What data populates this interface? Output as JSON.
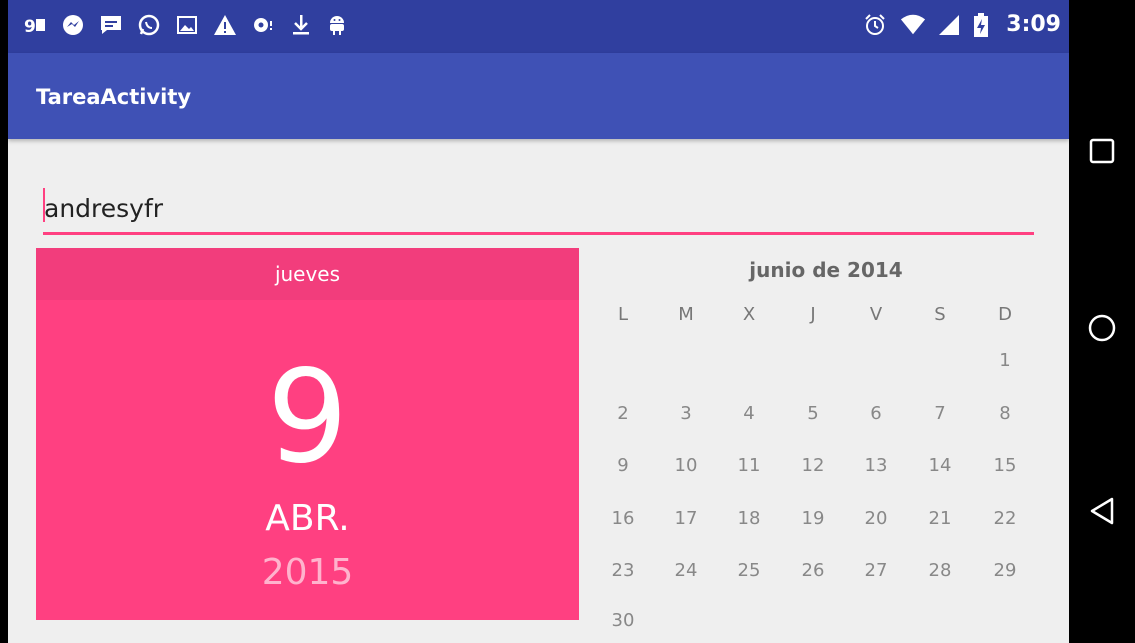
{
  "status_bar": {
    "left_icons": [
      "notification-flag-icon",
      "messenger-icon",
      "chat-icon",
      "whatsapp-icon",
      "image-icon",
      "warning-icon",
      "voicemail-icon",
      "download-icon",
      "android-icon"
    ],
    "right_icons": [
      "alarm-icon",
      "wifi-icon",
      "signal-icon",
      "battery-icon"
    ],
    "time": "3:09"
  },
  "app_bar": {
    "title": "TareaActivity"
  },
  "form": {
    "name_value": "andresyfr"
  },
  "date_header": {
    "weekday": "jueves",
    "day": "9",
    "month": "ABR.",
    "year": "2015"
  },
  "calendar": {
    "month_title": "junio de 2014",
    "weekdays": [
      "L",
      "M",
      "X",
      "J",
      "V",
      "S",
      "D"
    ],
    "weeks": [
      [
        "",
        "",
        "",
        "",
        "",
        "",
        "1"
      ],
      [
        "2",
        "3",
        "4",
        "5",
        "6",
        "7",
        "8"
      ],
      [
        "9",
        "10",
        "11",
        "12",
        "13",
        "14",
        "15"
      ],
      [
        "16",
        "17",
        "18",
        "19",
        "20",
        "21",
        "22"
      ],
      [
        "23",
        "24",
        "25",
        "26",
        "27",
        "28",
        "29"
      ],
      [
        "30",
        "",
        "",
        "",
        "",
        "",
        ""
      ]
    ]
  },
  "nav_bar": {
    "buttons": [
      "recents-icon",
      "home-icon",
      "back-icon"
    ]
  },
  "colors": {
    "status_bar": "#303f9f",
    "app_bar": "#3f51b5",
    "accent": "#ff4081"
  }
}
